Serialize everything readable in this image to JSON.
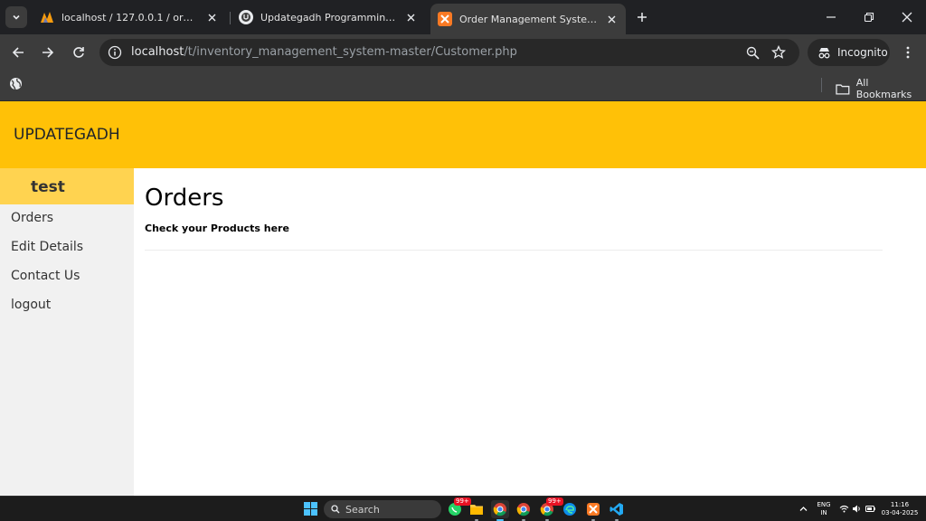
{
  "browser": {
    "tabs": [
      {
        "title": "localhost / 127.0.0.1 / order_mgmt",
        "favicon": "phpmyadmin-icon"
      },
      {
        "title": "Updategadh Programming - Upda",
        "favicon": "updategadh-icon"
      },
      {
        "title": "Order Management System-Custo",
        "favicon": "xampp-icon",
        "active": true
      }
    ],
    "address": {
      "host": "localhost",
      "path": "/t/inventory_management_system-master/Customer.php"
    },
    "incognito_label": "Incognito",
    "bookmarks": {
      "all_label": "All Bookmarks"
    }
  },
  "site": {
    "brand": "UPDATEGADH",
    "user": "test",
    "nav": [
      "Orders",
      "Edit Details",
      "Contact Us",
      "logout"
    ],
    "page_title": "Orders",
    "page_subtitle": "Check your Products here"
  },
  "taskbar": {
    "search_label": "Search",
    "badge": "99+",
    "lang_top": "ENG",
    "lang_bottom": "IN",
    "time": "11:16",
    "date": "03-04-2025"
  },
  "colors": {
    "accent": "#ffc107",
    "user_box": "#ffd350",
    "sidebar": "#f1f1f1"
  }
}
